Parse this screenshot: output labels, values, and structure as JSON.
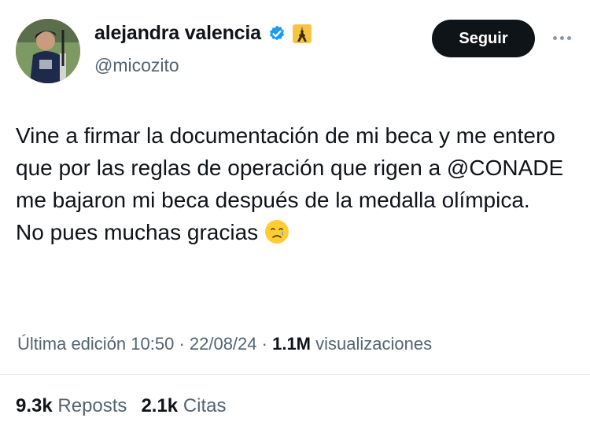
{
  "author": {
    "name": "alejandra valencia",
    "handle": "@micozito",
    "follow_label": "Seguir"
  },
  "tweet": {
    "lines": [
      "Vine a firmar la documentación de mi beca y me entero que por las reglas de operación que rigen a @CONADE me bajaron mi beca después de la medalla olímpica.",
      "No pues muchas gracias"
    ],
    "emoji": "crying-face"
  },
  "meta": {
    "edited_label": "Última edición 10:50 · 22/08/24",
    "separator": " · ",
    "views_count": "1.1M",
    "views_label": "visualizaciones"
  },
  "stats": {
    "reposts_count": "9.3k",
    "reposts_label": "Reposts",
    "quotes_count": "2.1k",
    "quotes_label": "Citas"
  },
  "colors": {
    "text": "#0f1419",
    "secondary": "#536471",
    "verified": "#1d9bf0",
    "button": "#0f1419"
  },
  "icons": [
    "verified-badge-icon",
    "eiffel-tower-icon",
    "more-icon",
    "crying-face-emoji"
  ]
}
